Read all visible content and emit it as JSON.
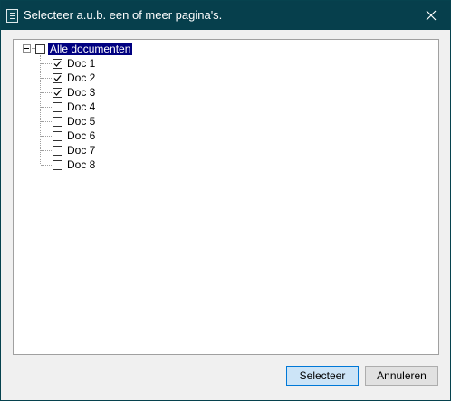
{
  "window": {
    "title": "Selecteer a.u.b. een of meer pagina's.",
    "title_icon": "document-list-icon",
    "close_icon": "close-icon"
  },
  "tree": {
    "root": {
      "label": "Alle documenten",
      "checked": false,
      "expanded": true,
      "selected": true
    },
    "items": [
      {
        "label": "Doc 1",
        "checked": true
      },
      {
        "label": "Doc 2",
        "checked": true
      },
      {
        "label": "Doc 3",
        "checked": true
      },
      {
        "label": "Doc 4",
        "checked": false
      },
      {
        "label": "Doc 5",
        "checked": false
      },
      {
        "label": "Doc 6",
        "checked": false
      },
      {
        "label": "Doc 7",
        "checked": false
      },
      {
        "label": "Doc 8",
        "checked": false
      }
    ]
  },
  "buttons": {
    "select_label": "Selecteer",
    "cancel_label": "Annuleren"
  },
  "colors": {
    "titlebar": "#063f4c",
    "selection": "#000080",
    "primary_button": "#cce4f7",
    "primary_border": "#0078d7"
  }
}
